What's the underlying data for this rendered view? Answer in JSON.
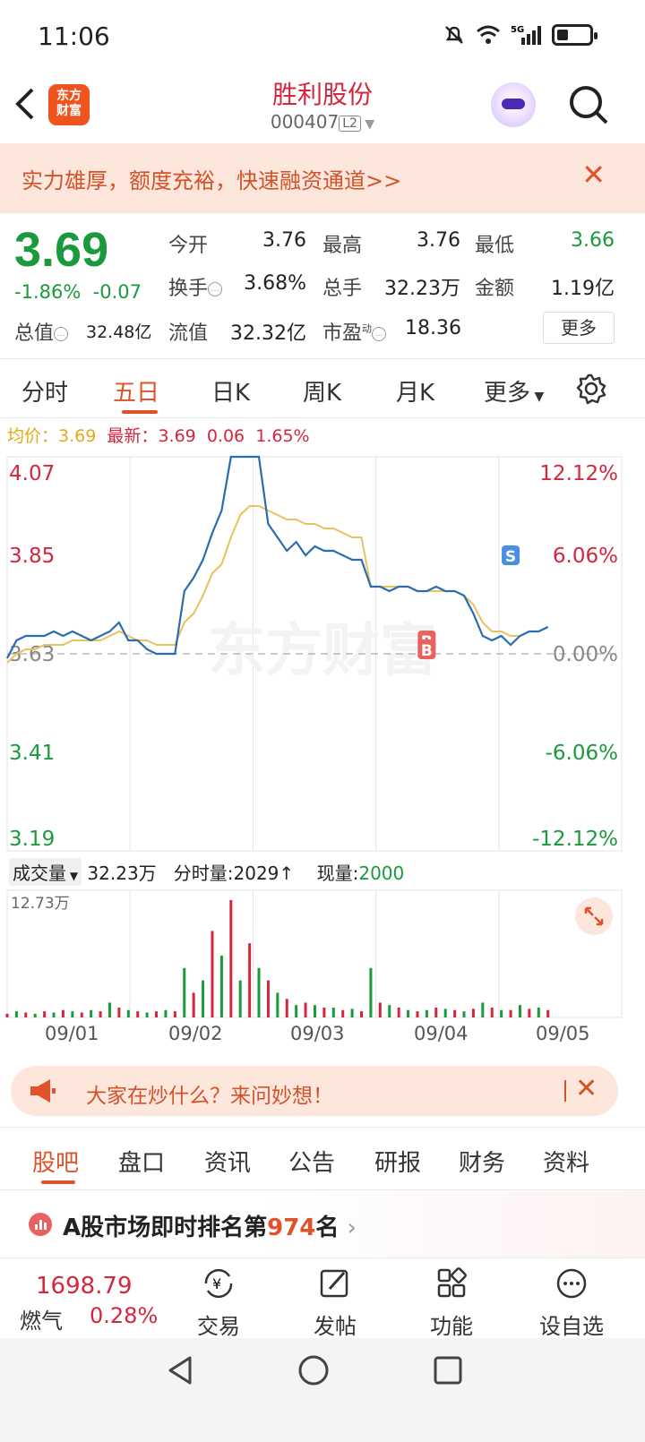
{
  "status": {
    "time": "11:06",
    "network": "5G"
  },
  "header": {
    "back_icon": "chevron-left-icon",
    "logo_text": "东方财富",
    "title": "胜利股份",
    "code": "000407",
    "level": "L2"
  },
  "banner": {
    "text": "实力雄厚，额度充裕，快速融资通道>>",
    "close": "✕"
  },
  "quote": {
    "price": "3.69",
    "change_pct": "-1.86%",
    "change_abs": "-0.07",
    "open_label": "今开",
    "open": "3.76",
    "high_label": "最高",
    "high": "3.76",
    "low_label": "最低",
    "low": "3.66",
    "turnover_label": "换手",
    "turnover": "3.68%",
    "volume_label": "总手",
    "volume": "32.23万",
    "amount_label": "金额",
    "amount": "1.19亿",
    "mktcap_label": "总值",
    "mktcap": "32.48亿",
    "float_label": "流值",
    "float": "32.32亿",
    "pe_label": "市盈",
    "pe_sup": "动",
    "pe": "18.36",
    "more": "更多"
  },
  "tabs": {
    "items": [
      "分时",
      "五日",
      "日K",
      "周K",
      "月K",
      "更多"
    ],
    "active": "五日"
  },
  "legend": {
    "avg_label": "均价：",
    "avg": "3.69",
    "latest_label": "最新：",
    "latest": "3.69",
    "latest_chg": "0.06",
    "latest_pct": "1.65%"
  },
  "chart_data": {
    "type": "line",
    "y_labels_left": [
      "4.07",
      "3.85",
      "3.63",
      "3.41",
      "3.19"
    ],
    "y_labels_right": [
      "12.12%",
      "6.06%",
      "0.00%",
      "-6.06%",
      "-12.12%"
    ],
    "ylim": [
      3.19,
      4.07
    ],
    "baseline": 3.63,
    "x_dates": [
      "09/01",
      "09/02",
      "09/03",
      "09/04",
      "09/05"
    ],
    "series": [
      {
        "values": [
          3.62,
          3.66,
          3.67,
          3.67,
          3.67,
          3.68,
          3.67,
          3.68,
          3.67,
          3.66,
          3.67,
          3.68,
          3.7,
          3.66,
          3.66,
          3.64,
          3.63,
          3.63,
          3.63,
          3.77,
          3.8,
          3.84,
          3.9,
          3.95,
          4.07,
          4.07,
          4.07,
          4.07,
          3.92,
          3.89,
          3.86,
          3.88,
          3.85,
          3.87,
          3.86,
          3.86,
          3.85,
          3.84,
          3.84,
          3.78,
          3.78,
          3.77,
          3.78,
          3.78,
          3.77,
          3.77,
          3.78,
          3.77,
          3.77,
          3.76,
          3.72,
          3.67,
          3.66,
          3.67,
          3.65,
          3.67,
          3.68,
          3.68,
          3.69
        ]
      },
      {
        "values": [
          3.61,
          3.63,
          3.64,
          3.64,
          3.65,
          3.65,
          3.65,
          3.66,
          3.66,
          3.66,
          3.66,
          3.67,
          3.68,
          3.67,
          3.66,
          3.66,
          3.65,
          3.65,
          3.65,
          3.7,
          3.72,
          3.76,
          3.81,
          3.83,
          3.89,
          3.94,
          3.96,
          3.96,
          3.95,
          3.94,
          3.93,
          3.93,
          3.92,
          3.92,
          3.91,
          3.91,
          3.9,
          3.89,
          3.89,
          3.78,
          3.78,
          3.78,
          3.78,
          3.78,
          3.77,
          3.77,
          3.77,
          3.77,
          3.77,
          3.76,
          3.74,
          3.7,
          3.68,
          3.68,
          3.67,
          3.67,
          3.68,
          3.68,
          3.69
        ]
      }
    ],
    "markers": [
      {
        "text": "S",
        "index": 54,
        "value": 3.85,
        "color": "#4a90e2"
      },
      {
        "text": "B",
        "index": 45,
        "value": 3.66,
        "color": "#e96262"
      },
      {
        "text": "B",
        "index": 45,
        "value": 3.64,
        "color": "#e96262"
      }
    ],
    "watermark": "东方财富"
  },
  "volume": {
    "label": "成交量",
    "total": "32.23万",
    "tick_label": "分时量:",
    "tick": "2029",
    "tick_arrow": "↑",
    "now_label": "现量:",
    "now": "2000",
    "max_label": "12.73万",
    "bars": [
      0.03,
      0.05,
      0.04,
      0.03,
      0.05,
      0.04,
      0.06,
      0.05,
      0.04,
      0.06,
      0.05,
      0.12,
      0.08,
      0.06,
      0.05,
      0.04,
      0.05,
      0.06,
      0.05,
      0.4,
      0.2,
      0.3,
      0.7,
      0.5,
      0.95,
      0.3,
      0.6,
      0.4,
      0.3,
      0.2,
      0.15,
      0.1,
      0.12,
      0.1,
      0.08,
      0.08,
      0.06,
      0.07,
      0.05,
      0.4,
      0.12,
      0.1,
      0.08,
      0.06,
      0.05,
      0.06,
      0.08,
      0.07,
      0.06,
      0.05,
      0.07,
      0.12,
      0.08,
      0.06,
      0.06,
      0.1,
      0.07,
      0.08,
      0.06
    ],
    "bar_colors": [
      "#d6263d",
      "#1a9a3c"
    ]
  },
  "ask": {
    "text": "大家在炒什么？来问妙想！",
    "close": "✕"
  },
  "subtabs": {
    "items": [
      "股吧",
      "盘口",
      "资讯",
      "公告",
      "研报",
      "财务",
      "资料"
    ],
    "active": "股吧"
  },
  "rank": {
    "prefix": "A股市场即时排名第",
    "num": "974",
    "suffix": "名",
    "arrow": "›"
  },
  "bottom": {
    "index_value": "1698.79",
    "index_name": "燃气",
    "index_pct": "0.28%",
    "trade": "交易",
    "post": "发帖",
    "func": "功能",
    "watch": "设自选"
  }
}
